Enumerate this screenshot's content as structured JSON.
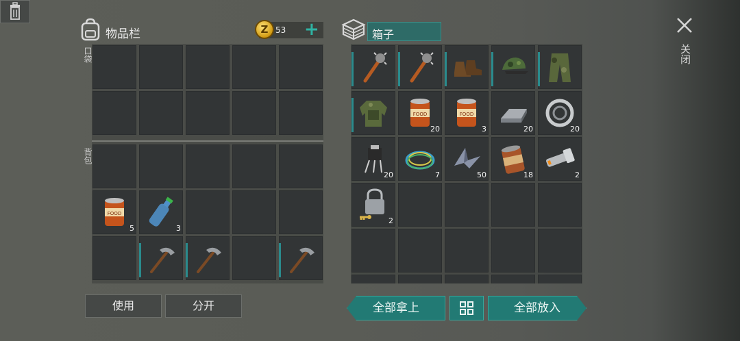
{
  "inventory": {
    "title": "物品栏",
    "coin_count": "53",
    "coin_letter": "Z",
    "pocket_label": "口袋",
    "backpack_label": "背包",
    "use_label": "使用",
    "split_label": "分开"
  },
  "box": {
    "title": "箱子",
    "take_all_label": "全部拿上",
    "put_all_label": "全部放入"
  },
  "close_label": "关闭",
  "left_items": [
    {
      "icon": "food-can-icon",
      "count": "5"
    },
    {
      "icon": "water-bottle-icon",
      "count": "3"
    },
    {
      "icon": "pickaxe-icon",
      "count": ""
    },
    {
      "icon": "pickaxe-icon",
      "count": ""
    },
    {
      "icon": "pickaxe-icon",
      "count": ""
    }
  ],
  "box_items": [
    {
      "icon": "spiked-club-icon",
      "count": ""
    },
    {
      "icon": "spiked-club-icon",
      "count": ""
    },
    {
      "icon": "boots-icon",
      "count": ""
    },
    {
      "icon": "camo-cap-icon",
      "count": ""
    },
    {
      "icon": "camo-pants-icon",
      "count": ""
    },
    {
      "icon": "camo-jacket-icon",
      "count": ""
    },
    {
      "icon": "food-can-icon",
      "count": "20"
    },
    {
      "icon": "food-can-icon",
      "count": "3"
    },
    {
      "icon": "metal-ingot-icon",
      "count": "20"
    },
    {
      "icon": "bearing-icon",
      "count": "20"
    },
    {
      "icon": "electronic-component-icon",
      "count": "20"
    },
    {
      "icon": "wire-coil-icon",
      "count": "7"
    },
    {
      "icon": "scrap-metal-icon",
      "count": "50"
    },
    {
      "icon": "rusty-can-icon",
      "count": "18"
    },
    {
      "icon": "flashlight-icon",
      "count": "2"
    },
    {
      "icon": "padlock-key-icon",
      "count": "2"
    }
  ],
  "colors": {
    "accent": "#2a8b8d",
    "teal_button": "#227a74",
    "coin": "#d29b12"
  }
}
